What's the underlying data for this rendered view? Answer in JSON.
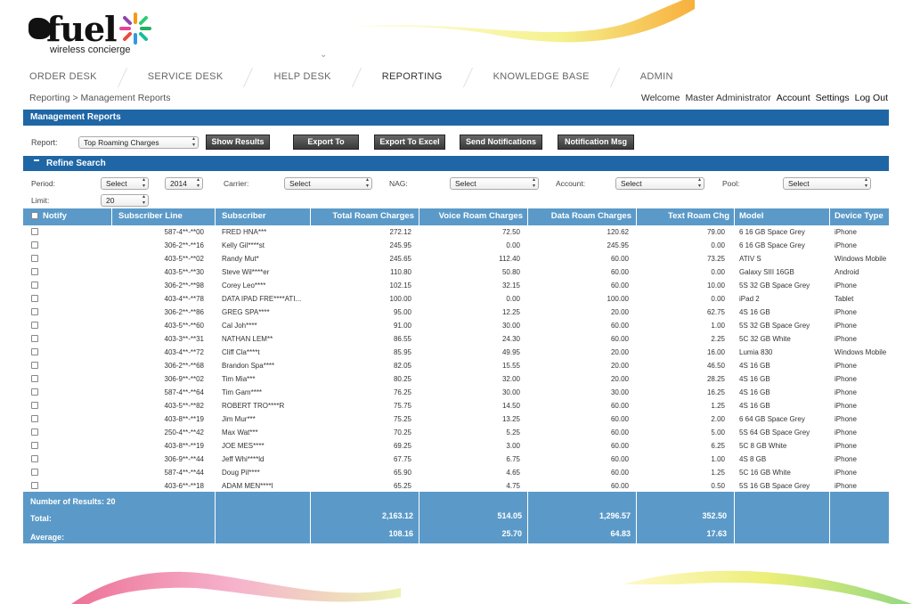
{
  "logo": {
    "word": "fuel",
    "tagline": "wireless concierge"
  },
  "nav": [
    "ORDER DESK",
    "SERVICE DESK",
    "HELP DESK",
    "REPORTING",
    "KNOWLEDGE BASE",
    "ADMIN"
  ],
  "nav_active": "REPORTING",
  "breadcrumb": "Reporting > Management Reports",
  "user": {
    "welcome": "Welcome",
    "name": "Master Administrator",
    "account": "Account",
    "settings": "Settings",
    "logout": "Log Out"
  },
  "panel_title": "Management Reports",
  "report": {
    "label": "Report:",
    "value": "Top Roaming Charges"
  },
  "buttons": {
    "show": "Show Results",
    "csv": "Export To CSV",
    "excel": "Export To Excel",
    "notify": "Send Notifications",
    "msg": "Notification Msg"
  },
  "refine_title": "Refine Search",
  "filters": {
    "period_label": "Period:",
    "period_value": "Select",
    "year_value": "2014",
    "carrier_label": "Carrier:",
    "carrier_value": "Select",
    "nag_label": "NAG:",
    "nag_value": "Select",
    "account_label": "Account:",
    "account_value": "Select",
    "pool_label": "Pool:",
    "pool_value": "Select",
    "limit_label": "Limit:",
    "limit_value": "20"
  },
  "columns": [
    "Notify",
    "Subscriber Line",
    "Subscriber",
    "Total Roam Charges",
    "Voice Roam Charges",
    "Data Roam Charges",
    "Text Roam Chg",
    "Model",
    "Device Type"
  ],
  "rows": [
    [
      "587-4**-**00",
      "FRED HNA***",
      "272.12",
      "72.50",
      "120.62",
      "79.00",
      "6 16 GB Space Grey",
      "iPhone"
    ],
    [
      "306-2**-**16",
      "Kelly Gil****st",
      "245.95",
      "0.00",
      "245.95",
      "0.00",
      "6 16 GB Space Grey",
      "iPhone"
    ],
    [
      "403-5**-**02",
      "Randy Mut*",
      "245.65",
      "112.40",
      "60.00",
      "73.25",
      "ATIV S",
      "Windows Mobile"
    ],
    [
      "403-5**-**30",
      "Steve Wil****er",
      "110.80",
      "50.80",
      "60.00",
      "0.00",
      "Galaxy SIII 16GB",
      "Android"
    ],
    [
      "306-2**-**98",
      "Corey Leo****",
      "102.15",
      "32.15",
      "60.00",
      "10.00",
      "5S 32 GB Space Grey",
      "iPhone"
    ],
    [
      "403-4**-**78",
      "DATA IPAD FRE****ATI...",
      "100.00",
      "0.00",
      "100.00",
      "0.00",
      "iPad 2",
      "Tablet"
    ],
    [
      "306-2**-**86",
      "GREG SPA****",
      "95.00",
      "12.25",
      "20.00",
      "62.75",
      "4S 16 GB",
      "iPhone"
    ],
    [
      "403-5**-**60",
      "Cal Joh****",
      "91.00",
      "30.00",
      "60.00",
      "1.00",
      "5S 32 GB Space Grey",
      "iPhone"
    ],
    [
      "403-3**-**31",
      "NATHAN LEM**",
      "86.55",
      "24.30",
      "60.00",
      "2.25",
      "5C 32 GB White",
      "iPhone"
    ],
    [
      "403-4**-**72",
      "Cliff Cla****t",
      "85.95",
      "49.95",
      "20.00",
      "16.00",
      "Lumia 830",
      "Windows Mobile"
    ],
    [
      "306-2**-**68",
      "Brandon Spa****",
      "82.05",
      "15.55",
      "20.00",
      "46.50",
      "4S 16 GB",
      "iPhone"
    ],
    [
      "306-9**-**02",
      "Tim Mia***",
      "80.25",
      "32.00",
      "20.00",
      "28.25",
      "4S 16 GB",
      "iPhone"
    ],
    [
      "587-4**-**64",
      "Tim Gam****",
      "76.25",
      "30.00",
      "30.00",
      "16.25",
      "4S 16 GB",
      "iPhone"
    ],
    [
      "403-5**-**82",
      "ROBERT TRO****R",
      "75.75",
      "14.50",
      "60.00",
      "1.25",
      "4S 16 GB",
      "iPhone"
    ],
    [
      "403-8**-**19",
      "Jim Mur***",
      "75.25",
      "13.25",
      "60.00",
      "2.00",
      "6 64 GB Space Grey",
      "iPhone"
    ],
    [
      "250-4**-**42",
      "Max Wat***",
      "70.25",
      "5.25",
      "60.00",
      "5.00",
      "5S 64 GB Space Grey",
      "iPhone"
    ],
    [
      "403-8**-**19",
      "JOE MES****",
      "69.25",
      "3.00",
      "60.00",
      "6.25",
      "5C 8 GB White",
      "iPhone"
    ],
    [
      "306-9**-**44",
      "Jeff Whi****ld",
      "67.75",
      "6.75",
      "60.00",
      "1.00",
      "4S 8 GB",
      "iPhone"
    ],
    [
      "587-4**-**44",
      "Doug Pil****",
      "65.90",
      "4.65",
      "60.00",
      "1.25",
      "5C 16 GB White",
      "iPhone"
    ],
    [
      "403-6**-**18",
      "ADAM MEN****l",
      "65.25",
      "4.75",
      "60.00",
      "0.50",
      "5S 16 GB Space Grey",
      "iPhone"
    ]
  ],
  "footer": {
    "count_label": "Number of Results: 20",
    "total_label": "Total:",
    "average_label": "Average:",
    "totals": [
      "2,163.12",
      "514.05",
      "1,296.57",
      "352.50"
    ],
    "averages": [
      "108.16",
      "25.70",
      "64.83",
      "17.63"
    ]
  },
  "colors": {
    "bar": "#1e66a5",
    "table_header": "#5b9ac8",
    "button": "#444444"
  }
}
